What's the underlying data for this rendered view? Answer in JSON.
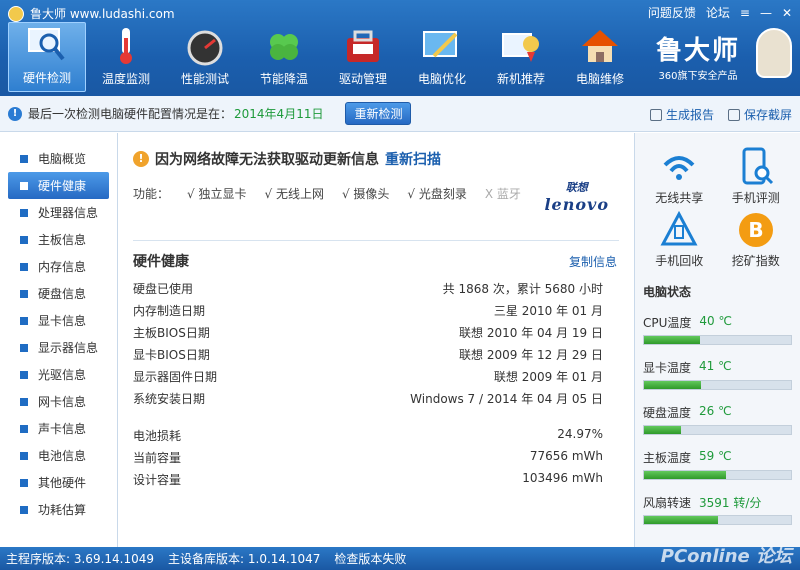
{
  "app": {
    "title": "鲁大师 www.ludashi.com"
  },
  "window_links": [
    "问题反馈",
    "论坛"
  ],
  "nav": [
    {
      "label": "硬件检测",
      "icon": "monitor-magnifier-icon"
    },
    {
      "label": "温度监测",
      "icon": "thermometer-icon"
    },
    {
      "label": "性能测试",
      "icon": "speedometer-icon"
    },
    {
      "label": "节能降温",
      "icon": "clover-icon"
    },
    {
      "label": "驱动管理",
      "icon": "toolbox-icon"
    },
    {
      "label": "电脑优化",
      "icon": "broom-icon"
    },
    {
      "label": "新机推荐",
      "icon": "award-monitor-icon"
    },
    {
      "label": "电脑维修",
      "icon": "house-icon"
    }
  ],
  "brand": {
    "name": "鲁大师",
    "tagline": "360旗下安全产品"
  },
  "infobar": {
    "text": "最后一次检测电脑硬件配置情况是在：",
    "date": "2014年4月11日",
    "recheck_label": "重新检测",
    "report_label": "生成报告",
    "screenshot_label": "保存截屏"
  },
  "sidebar": [
    "电脑概览",
    "硬件健康",
    "处理器信息",
    "主板信息",
    "内存信息",
    "硬盘信息",
    "显卡信息",
    "显示器信息",
    "光驱信息",
    "网卡信息",
    "声卡信息",
    "电池信息",
    "其他硬件",
    "功耗估算"
  ],
  "main": {
    "warning": "因为网络故障无法获取驱动更新信息",
    "rescan_label": "重新扫描",
    "features_label": "功能：",
    "features": [
      {
        "text": "√ 独立显卡",
        "enabled": true
      },
      {
        "text": "√ 无线上网",
        "enabled": true
      },
      {
        "text": "√ 摄像头",
        "enabled": true
      },
      {
        "text": "√ 光盘刻录",
        "enabled": true
      },
      {
        "text": "X 蓝牙",
        "enabled": false
      }
    ],
    "vendor_cn": "联想",
    "vendor_en": "lenovo",
    "section_title": "硬件健康",
    "copy_label": "复制信息",
    "rows": [
      {
        "k": "硬盘已使用",
        "v": "共 1868 次，累计 5680 小时"
      },
      {
        "k": "内存制造日期",
        "v": "三星 2010 年 01 月"
      },
      {
        "k": "主板BIOS日期",
        "v": "联想 2010 年 04 月 19 日"
      },
      {
        "k": "显卡BIOS日期",
        "v": "联想 2009 年 12 月 29 日"
      },
      {
        "k": "显示器固件日期",
        "v": "联想 2009 年 01 月"
      },
      {
        "k": "系统安装日期",
        "v": "Windows 7 / 2014 年 04 月 05 日"
      },
      {
        "k": "电池损耗",
        "v": "24.97%"
      },
      {
        "k": "当前容量",
        "v": "77656 mWh"
      },
      {
        "k": "设计容量",
        "v": "103496 mWh"
      }
    ]
  },
  "right": {
    "tools": [
      {
        "label": "无线共享",
        "icon": "wifi-icon"
      },
      {
        "label": "手机评测",
        "icon": "phone-scan-icon"
      },
      {
        "label": "手机回收",
        "icon": "recycle-icon"
      },
      {
        "label": "挖矿指数",
        "icon": "bitcoin-icon"
      }
    ],
    "status_title": "电脑状态",
    "status": [
      {
        "label": "CPU温度",
        "value": "40 ℃",
        "level": 0.38
      },
      {
        "label": "显卡温度",
        "value": "41 ℃",
        "level": 0.39
      },
      {
        "label": "硬盘温度",
        "value": "26 ℃",
        "level": 0.25
      },
      {
        "label": "主板温度",
        "value": "59 ℃",
        "level": 0.56
      },
      {
        "label": "风扇转速",
        "value": "3591 转/分",
        "level": 0.5
      }
    ]
  },
  "statusbar": {
    "main_version": "主程序版本: 3.69.14.1049",
    "db_version": "主设备库版本: 1.0.14.1047",
    "check": "检查版本失败"
  },
  "watermark": "PConline 论坛"
}
